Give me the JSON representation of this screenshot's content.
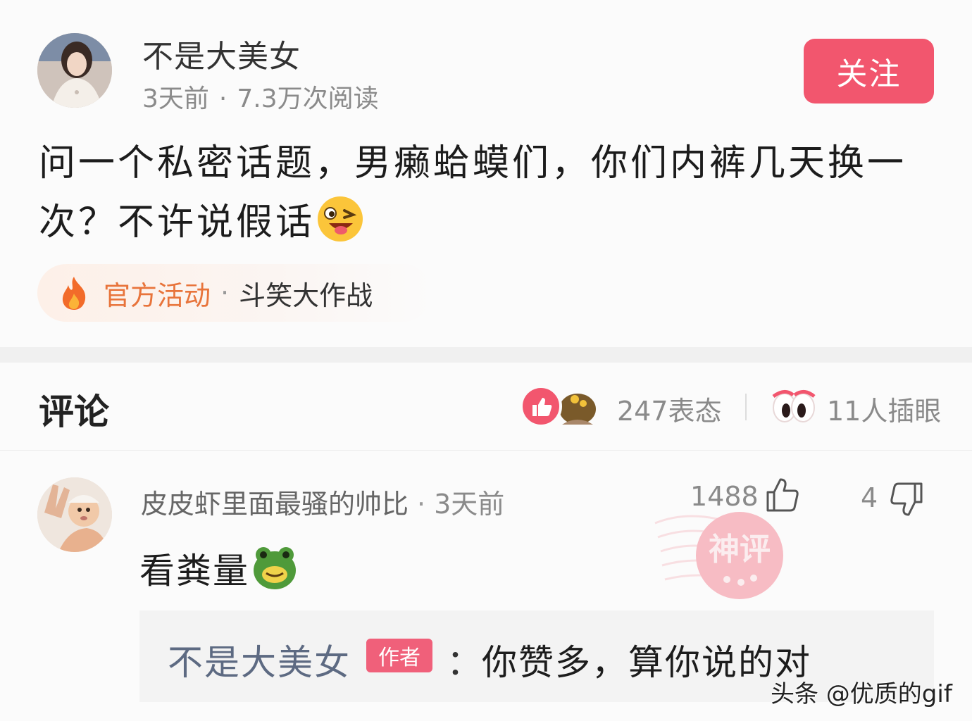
{
  "post": {
    "author": "不是大美女",
    "time": "3天前",
    "separator": "·",
    "reads": "7.3万次阅读",
    "follow_label": "关注",
    "text": "问一个私密话题，男癞蛤蟆们，你们内裤几天换一次？不许说假话",
    "text_emoji": "wink-tongue-emoji",
    "activity": {
      "icon": "fire-icon",
      "official": "官方活动",
      "separator": "·",
      "name": "斗笑大作战"
    }
  },
  "comments_header": {
    "title": "评论",
    "reactions_label": "247表态",
    "eyes_label": "11人插眼"
  },
  "comment": {
    "username": "皮皮虾里面最骚的帅比",
    "separator": "·",
    "time": "3天前",
    "likes": "1488",
    "dislikes": "4",
    "text": "看粪量",
    "text_emoji": "frog-emoji",
    "stamp": "神评",
    "reply": {
      "author": "不是大美女",
      "badge": "作者",
      "colon": "：",
      "text": "你赞多，算你说的对"
    }
  },
  "watermark": "头条 @优质的gif",
  "colors": {
    "accent": "#f2566e",
    "activity_orange": "#e8743b",
    "reply_name": "#5d6a82",
    "meta_gray": "#8a8a8a"
  }
}
